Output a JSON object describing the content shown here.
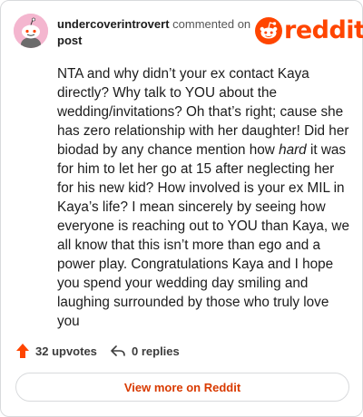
{
  "comment": {
    "username": "undercoverintrovert",
    "action_text": "commented on",
    "post_link_text": "post",
    "body_parts": [
      "NTA and why didn’t your ex contact Kaya directly? Why talk to YOU about the wedding/invitations? Oh that’s right; cause she has zero relationship with her daughter! Did her biodad by any chance mention how ",
      "hard",
      " it was for him to let her go at 15 after neglecting her for his new kid? How involved is your ex MIL in Kaya’s life? I mean sincerely by seeing how everyone is reaching out to YOU than Kaya, we all know that this isn’t more than ego and a power play. Congratulations Kaya and I hope you spend your wedding day smiling and laughing surrounded by those who truly love you"
    ]
  },
  "brand": {
    "logo_text": "reddit",
    "color": "#ff4500"
  },
  "footer": {
    "upvotes_label": "32 upvotes",
    "replies_label": "0 replies"
  },
  "view_more_label": "View more on Reddit",
  "colors": {
    "accent": "#ff4500",
    "link": "#d93a00",
    "avatar_bg": "#f4b6cf"
  }
}
